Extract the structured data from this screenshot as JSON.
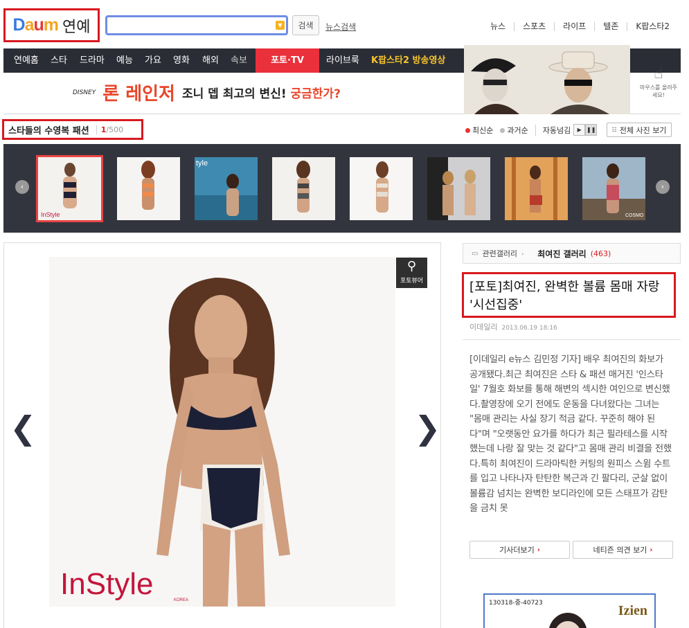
{
  "header": {
    "logo_letters": [
      "D",
      "a",
      "u",
      "m"
    ],
    "section": "연예",
    "search_button": "검색",
    "news_search": "뉴스검색",
    "top_links": [
      "뉴스",
      "스포츠",
      "라이프",
      "텔존",
      "K팝스타2"
    ]
  },
  "nav": {
    "items": [
      "연예홈",
      "스타",
      "드라마",
      "예능",
      "가요",
      "영화",
      "해외",
      "속보"
    ],
    "photo_tv": "포토·TV",
    "live_brook": "라이브룩",
    "kpop_video": "K팝스타2 방송영상"
  },
  "banner": {
    "disney": "DISNEY",
    "movie": "론 레인저",
    "tagline_pre": "조니 뎁",
    "tagline_mid": "최고의 변신!",
    "tagline_post": "궁금한가?",
    "mouse_hint": "마우스를 올려주세요!"
  },
  "gallery": {
    "title": "스타들의 수영복 패션",
    "current": "1",
    "total": "/500",
    "sort_newest": "최신순",
    "sort_oldest": "과거순",
    "auto_play": "자동넘김",
    "view_all": "전체 사진 보기",
    "thumb_count": 8,
    "selected_thumb": 1
  },
  "photo": {
    "magazine": "InStyle",
    "magazine_sub": "KOREA",
    "viewer_label": "포토뷰어"
  },
  "article": {
    "related_label": "관련갤러리",
    "related_name": "최여진 갤러리",
    "related_count": "(463)",
    "headline": "[포토]최여진, 완벽한 볼륨 몸매 자랑 '시선집중'",
    "source": "이데일리",
    "date": "2013.06.19 18:16",
    "body": "[이데일리 e뉴스 김민정 기자] 배우 최여진의 화보가 공개됐다.최근 최여진은 스타 & 패션 매거진 '인스타일' 7월호 화보를 통해 해변의 섹시한 여인으로 변신했다.촬영장에 오기 전에도 운동을 다녀왔다는 그녀는 \"몸매 관리는 사실 장기 적금 같다. 꾸준히 해야 된다\"며 \"오랫동안 요가를 하다가 최근 필라테스를 시작했는데 나랑 잘 맞는 것 같다\"고 몸매 관리 비결을 전했다.특히 최여진이 드라마틱한 커팅의 원피스 스윔 수트를 입고 나타나자 탄탄한 복근과 긴 팔다리, 군살 없이 볼륨감 넘치는 완벽한 보디라인에 모든 스태프가 감탄을 금치 못",
    "more_button": "기사더보기",
    "comments_button": "네티즌 의견 보기"
  },
  "ad": {
    "code": "130318-중-40723",
    "brand": "Izien"
  },
  "colors": {
    "nav_bg": "#2b2d36",
    "accent_red": "#e9303b",
    "highlight_box": "#d8181f",
    "strip_bg": "#33353e"
  }
}
